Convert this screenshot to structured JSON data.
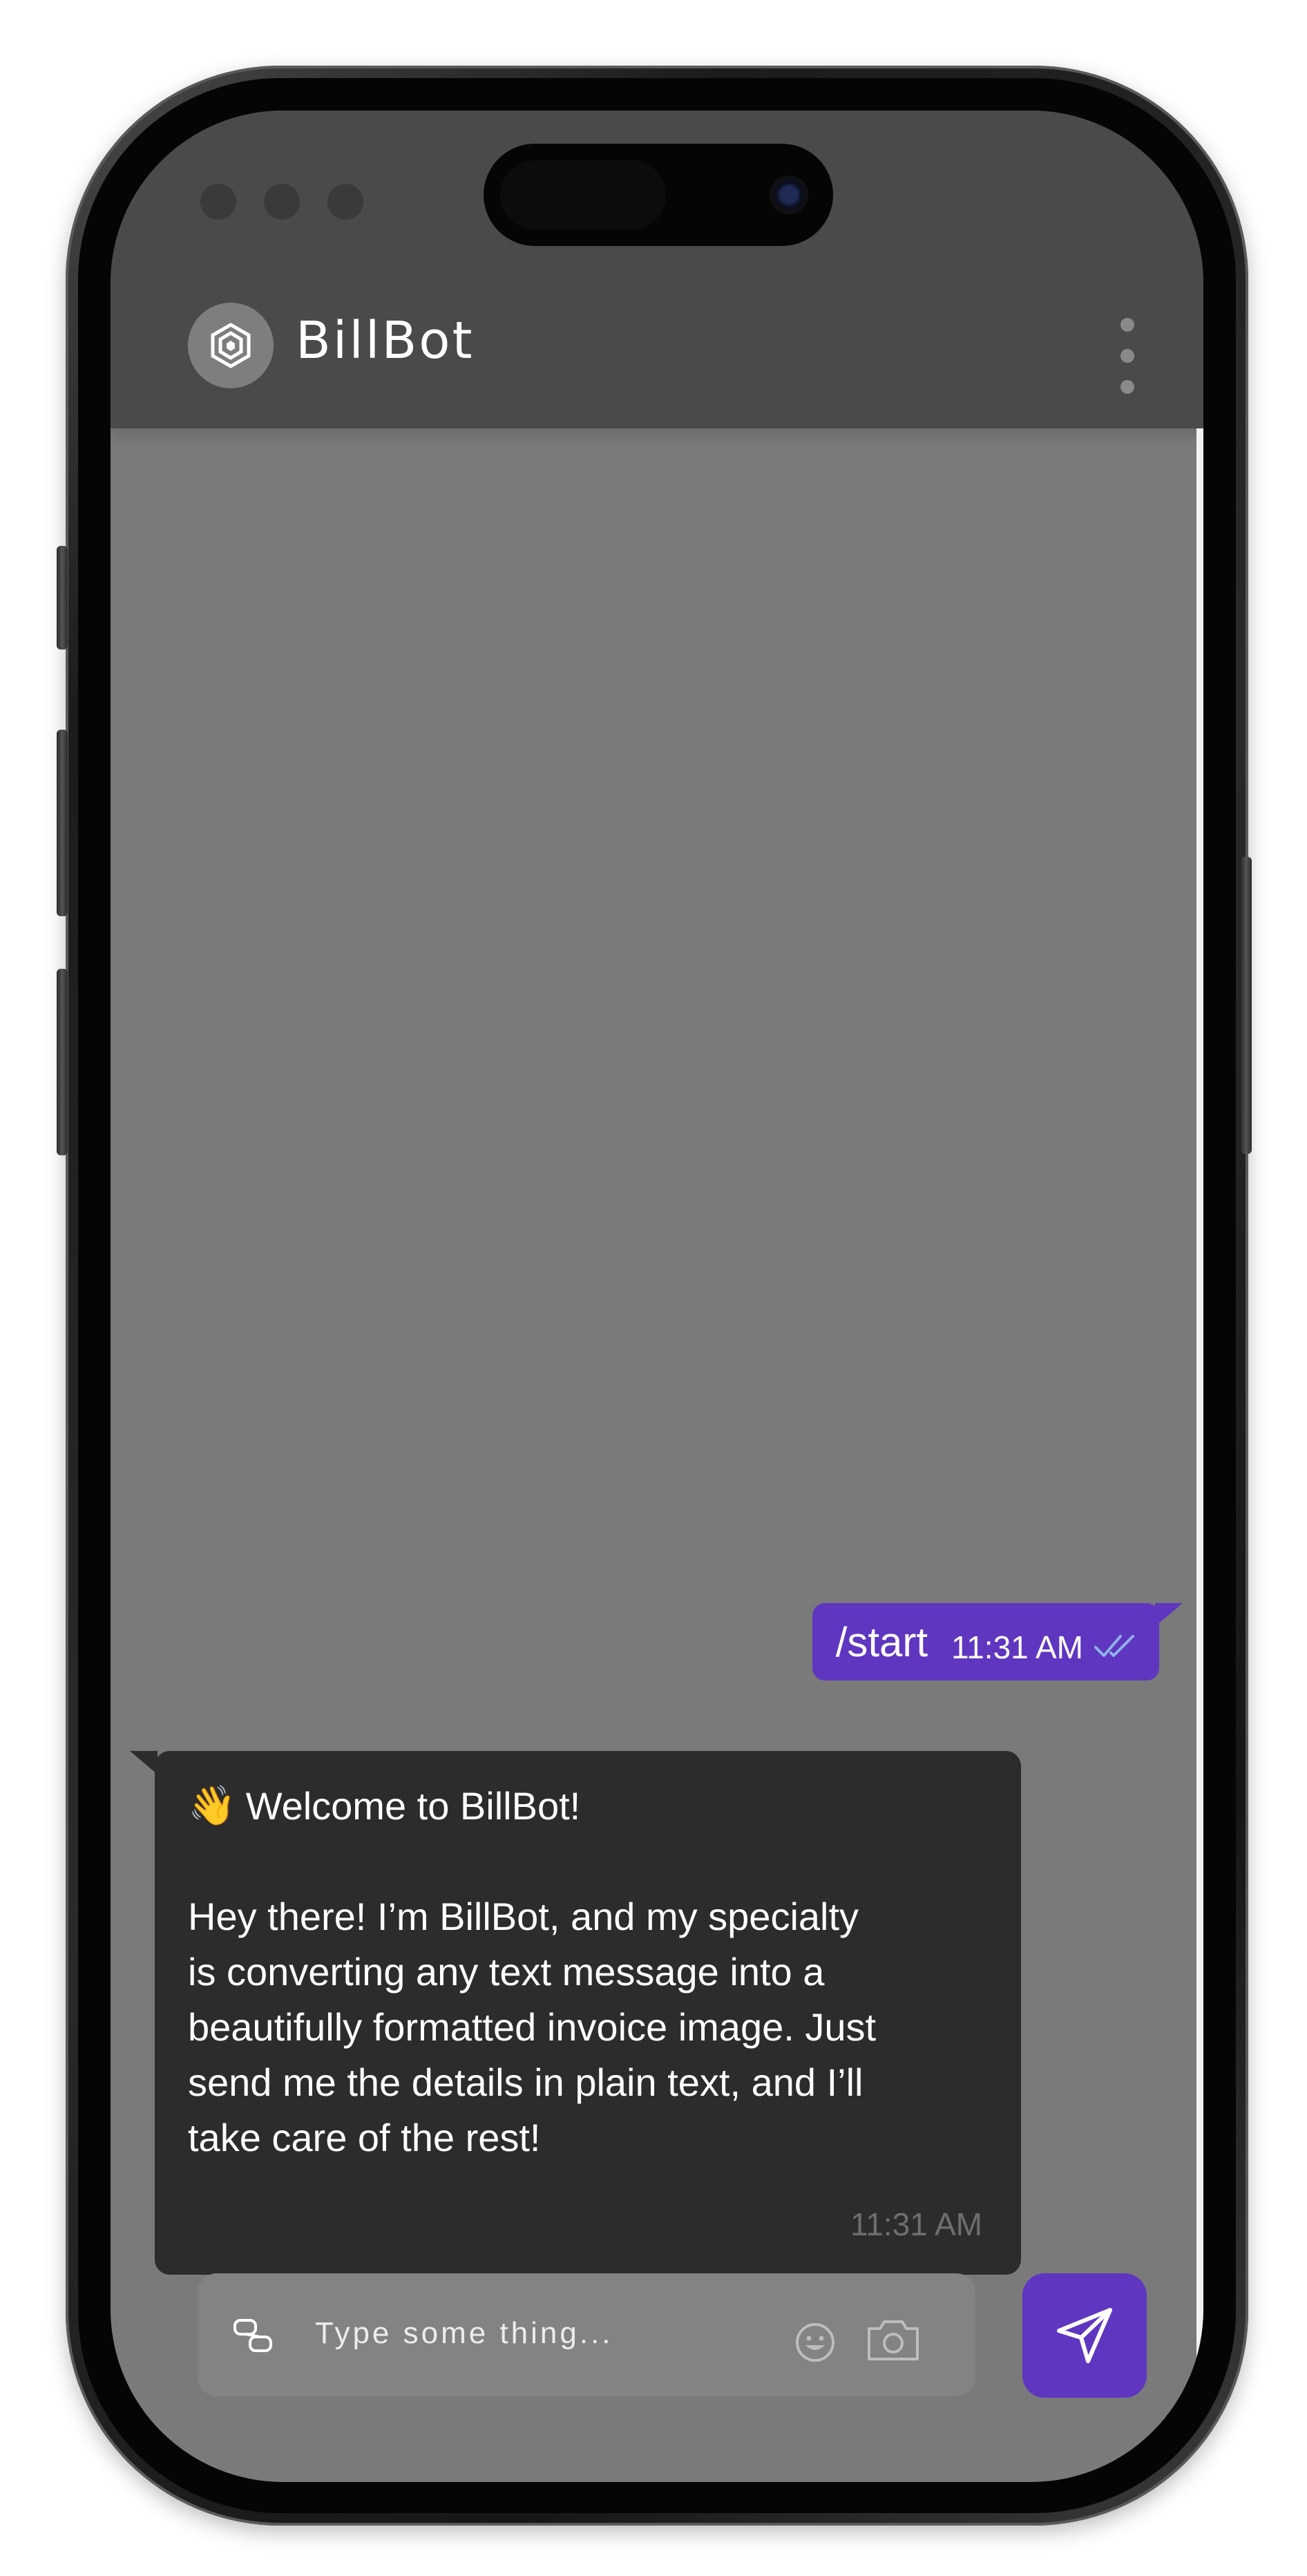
{
  "header": {
    "app_title": "BillBot",
    "avatar_icon": "hexagon-logo-icon",
    "menu_icon": "more-vertical-icon"
  },
  "messages": [
    {
      "direction": "outgoing",
      "text": "/start",
      "time": "11:31 AM",
      "status_icon": "double-check-icon"
    },
    {
      "direction": "incoming",
      "emoji": "👋",
      "title": "Welcome to BillBot!",
      "body": "Hey there!  I’m BillBot, and my specialty is converting any text message into a beautifully formatted invoice image. Just send me the details in plain text, and I’ll take care of the rest!",
      "time": "11:31 AM"
    }
  ],
  "composer": {
    "placeholder": "Type some thing...",
    "attach_icon": "link-icon",
    "emoji_icon": "smiley-icon",
    "camera_icon": "camera-icon",
    "send_icon": "paper-plane-icon"
  },
  "colors": {
    "accent": "#5f36c0",
    "header_bg": "#4a4a4a",
    "chat_bg": "#7a7a7a",
    "incoming_bubble": "#2c2c2c",
    "read_ticks": "#8fb3e8"
  }
}
